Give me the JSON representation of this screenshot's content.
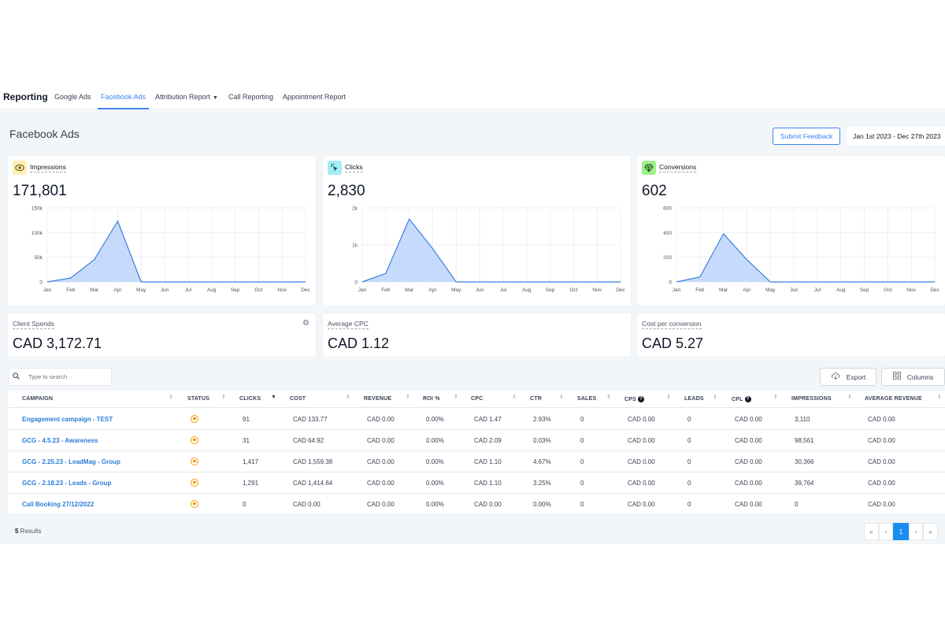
{
  "nav": {
    "brand": "Reporting",
    "tabs": [
      {
        "label": "Google Ads",
        "active": false
      },
      {
        "label": "Facebook Ads",
        "active": true
      },
      {
        "label": "Attribution Report",
        "active": false,
        "dropdown": true
      },
      {
        "label": "Call Reporting",
        "active": false
      },
      {
        "label": "Appointment Report",
        "active": false
      }
    ]
  },
  "page": {
    "title": "Facebook Ads",
    "feedback_label": "Submit Feedback",
    "date_range": "Jan 1st 2023 - Dec 27th 2023"
  },
  "cards": [
    {
      "label": "Impressions",
      "value": "171,801",
      "icon": "eye-icon",
      "badge_color": "#fdf0b4",
      "chart_data": {
        "type": "area",
        "categories": [
          "Jan",
          "Feb",
          "Mar",
          "Apr",
          "May",
          "Jun",
          "Jul",
          "Aug",
          "Sep",
          "Oct",
          "Nov",
          "Dec"
        ],
        "values": [
          0,
          8000,
          45000,
          123000,
          0,
          0,
          0,
          0,
          0,
          0,
          0,
          0
        ],
        "yticks": [
          "0",
          "50k",
          "100k",
          "150k"
        ],
        "ylim": [
          0,
          150000
        ]
      }
    },
    {
      "label": "Clicks",
      "value": "2,830",
      "icon": "cursor-click-icon",
      "badge_color": "#a5ecf4",
      "chart_data": {
        "type": "area",
        "categories": [
          "Jan",
          "Feb",
          "Mar",
          "Apr",
          "May",
          "Jun",
          "Jul",
          "Aug",
          "Sep",
          "Oct",
          "Nov",
          "Dec"
        ],
        "values": [
          0,
          230,
          1700,
          900,
          0,
          0,
          0,
          0,
          0,
          0,
          0,
          0
        ],
        "yticks": [
          "0",
          "1k",
          "2k"
        ],
        "ylim": [
          0,
          2000
        ]
      }
    },
    {
      "label": "Conversions",
      "value": "602",
      "icon": "diamond-icon",
      "badge_color": "#9ef08c",
      "chart_data": {
        "type": "area",
        "categories": [
          "Jan",
          "Feb",
          "Mar",
          "Apr",
          "May",
          "Jun",
          "Jul",
          "Aug",
          "Sep",
          "Oct",
          "Nov",
          "Dec"
        ],
        "values": [
          0,
          40,
          390,
          180,
          0,
          0,
          0,
          0,
          0,
          0,
          0,
          0
        ],
        "yticks": [
          "0",
          "200",
          "400",
          "600"
        ],
        "ylim": [
          0,
          600
        ]
      }
    }
  ],
  "stats": [
    {
      "label": "Client Spends",
      "value": "CAD 3,172.71",
      "has_settings": true
    },
    {
      "label": "Average CPC",
      "value": "CAD 1.12"
    },
    {
      "label": "Cost per conversion",
      "value": "CAD 5.27"
    }
  ],
  "search": {
    "placeholder": "Type to search"
  },
  "toolbar": {
    "export_label": "Export",
    "columns_label": "Columns"
  },
  "table": {
    "columns": [
      "CAMPAIGN",
      "STATUS",
      "CLICKS",
      "COST",
      "REVENUE",
      "ROI %",
      "CPC",
      "CTR",
      "SALES",
      "CPS",
      "LEADS",
      "CPL",
      "IMPRESSIONS",
      "AVERAGE REVENUE"
    ],
    "rows": [
      [
        "Engagement campaign - TEST",
        "paused",
        "91",
        "CAD 133.77",
        "CAD 0.00",
        "0.00%",
        "CAD 1.47",
        "2.93%",
        "0",
        "CAD 0.00",
        "0",
        "CAD 0.00",
        "3,110",
        "CAD 0.00"
      ],
      [
        "GCG - 4.5.23 - Awareness",
        "paused",
        "31",
        "CAD 64.92",
        "CAD 0.00",
        "0.00%",
        "CAD 2.09",
        "0.03%",
        "0",
        "CAD 0.00",
        "0",
        "CAD 0.00",
        "98,561",
        "CAD 0.00"
      ],
      [
        "GCG - 2.25.23 - LeadMag - Group",
        "paused",
        "1,417",
        "CAD 1,559.38",
        "CAD 0.00",
        "0.00%",
        "CAD 1.10",
        "4.67%",
        "0",
        "CAD 0.00",
        "0",
        "CAD 0.00",
        "30,366",
        "CAD 0.00"
      ],
      [
        "GCG - 2.18.23 - Leads - Group",
        "paused",
        "1,291",
        "CAD 1,414.64",
        "CAD 0.00",
        "0.00%",
        "CAD 1.10",
        "3.25%",
        "0",
        "CAD 0.00",
        "0",
        "CAD 0.00",
        "39,764",
        "CAD 0.00"
      ],
      [
        "Call Booking 27/12/2022",
        "paused",
        "0",
        "CAD 0.00",
        "CAD 0.00",
        "0.00%",
        "CAD 0.00",
        "0.00%",
        "0",
        "CAD 0.00",
        "0",
        "CAD 0.00",
        "0",
        "CAD 0.00"
      ]
    ]
  },
  "footer": {
    "results_count": "5",
    "results_label": " Results",
    "pager": {
      "first": "«",
      "prev": "‹",
      "current": "1",
      "next": "›",
      "last": "»"
    }
  },
  "colors": {
    "accent": "#3b82f6",
    "link": "#2b7dd6",
    "area_fill": "#bcd5fb",
    "line": "#3b7ee0",
    "paused": "#f59e0b"
  }
}
